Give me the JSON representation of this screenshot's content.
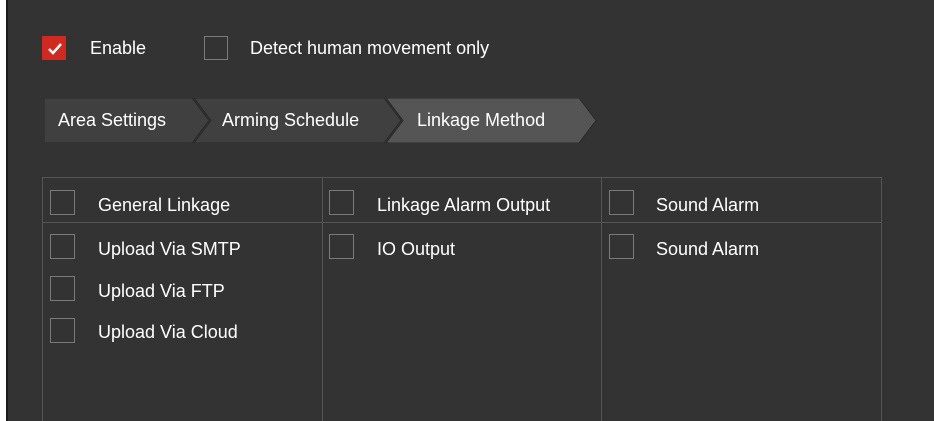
{
  "header": {
    "enable": {
      "label": "Enable",
      "checked": true
    },
    "detect_human": {
      "label": "Detect human movement only",
      "checked": false
    }
  },
  "tabs": [
    {
      "label": "Area Settings",
      "active": false
    },
    {
      "label": "Arming Schedule",
      "active": false
    },
    {
      "label": "Linkage Method",
      "active": true
    }
  ],
  "linkage": {
    "columns": [
      {
        "header": {
          "label": "General Linkage",
          "checked": false
        },
        "items": [
          {
            "label": "Upload Via SMTP",
            "checked": false
          },
          {
            "label": "Upload Via FTP",
            "checked": false
          },
          {
            "label": "Upload Via Cloud",
            "checked": false
          }
        ]
      },
      {
        "header": {
          "label": "Linkage Alarm Output",
          "checked": false
        },
        "items": [
          {
            "label": "IO Output",
            "checked": false
          }
        ]
      },
      {
        "header": {
          "label": "Sound Alarm",
          "checked": false
        },
        "items": [
          {
            "label": "Sound Alarm",
            "checked": false
          }
        ]
      }
    ]
  },
  "colors": {
    "panel_bg": "#333333",
    "accent_checked": "#d02a20",
    "tab_active": "#555555",
    "tab_inactive": "#404040",
    "grid_line": "#555555",
    "text": "#ffffff"
  },
  "icons": {
    "checkmark": "checkmark-icon"
  }
}
